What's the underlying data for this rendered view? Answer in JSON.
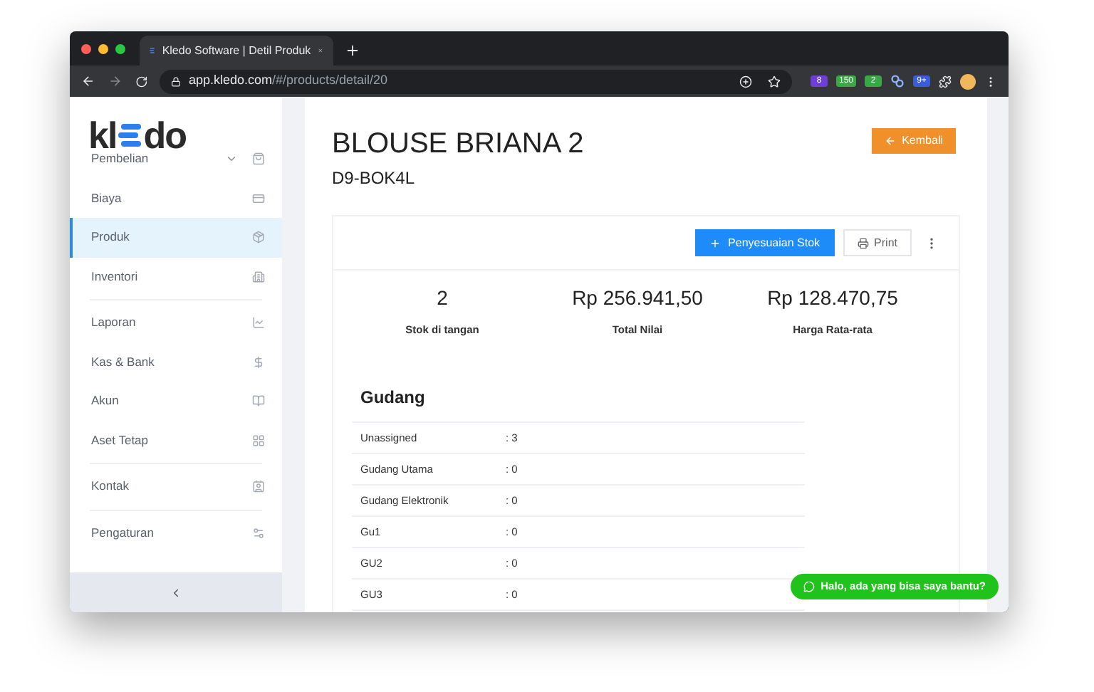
{
  "browser": {
    "tab_title": "Kledo Software | Detil Produk",
    "url_host": "app.kledo.com",
    "url_path": "/#/products/detail/20",
    "extension_badges": [
      "8",
      "150",
      "2",
      "9+"
    ]
  },
  "sidebar": {
    "logo": {
      "left": "kl",
      "right": "do"
    },
    "groups": [
      {
        "items": [
          {
            "label": "Pembelian",
            "expanded": false,
            "selected": false
          },
          {
            "label": "Biaya",
            "selected": false
          },
          {
            "label": "Produk",
            "selected": true
          },
          {
            "label": "Inventori",
            "selected": false
          }
        ]
      },
      {
        "items": [
          {
            "label": "Laporan",
            "selected": false
          },
          {
            "label": "Kas & Bank",
            "selected": false
          },
          {
            "label": "Akun",
            "selected": false
          },
          {
            "label": "Aset Tetap",
            "selected": false
          }
        ]
      },
      {
        "items": [
          {
            "label": "Kontak",
            "selected": false
          }
        ]
      },
      {
        "items": [
          {
            "label": "Pengaturan",
            "selected": false
          }
        ]
      }
    ]
  },
  "product": {
    "name": "BLOUSE BRIANA 2",
    "code": "D9-BOK4L",
    "back_button": "Kembali"
  },
  "toolbar": {
    "adjust_button": "Penyesuaian Stok",
    "print_button": "Print"
  },
  "stats": [
    {
      "value": "2",
      "label": "Stok di tangan"
    },
    {
      "value": "Rp 256.941,50",
      "label": "Total Nilai"
    },
    {
      "value": "Rp 128.470,75",
      "label": "Harga Rata-rata"
    }
  ],
  "warehouses": {
    "title": "Gudang",
    "rows": [
      {
        "name": "Unassigned",
        "qty": ": 3"
      },
      {
        "name": "Gudang Utama",
        "qty": ": 0"
      },
      {
        "name": "Gudang Elektronik",
        "qty": ": 0"
      },
      {
        "name": "Gu1",
        "qty": ": 0"
      },
      {
        "name": "GU2",
        "qty": ": 0"
      },
      {
        "name": "GU3",
        "qty": ": 0"
      }
    ]
  },
  "chat_bubble": "Halo, ada yang bisa saya bantu?"
}
